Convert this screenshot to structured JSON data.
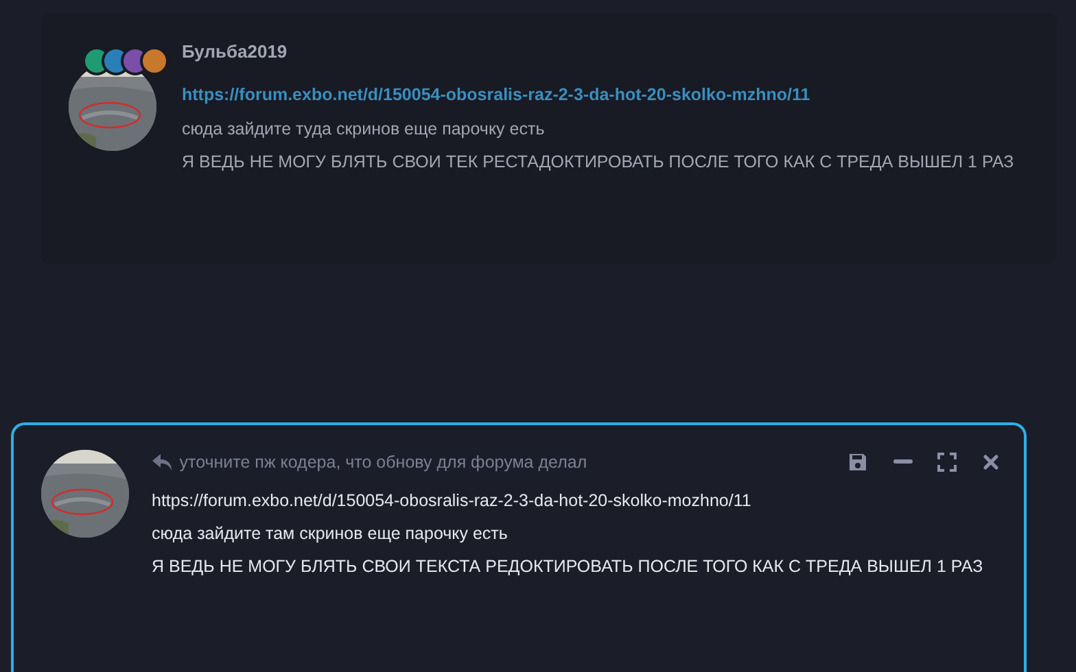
{
  "post": {
    "author": "Бульба2019",
    "badges": [
      {
        "color": "#1f9a72"
      },
      {
        "color": "#2a7fb8"
      },
      {
        "color": "#7b4fa8"
      },
      {
        "color": "#c8782a"
      }
    ],
    "link": "https://forum.exbo.net/d/150054-obosralis-raz-2-3-da-hot-20-skolko-mzhno/11",
    "lines": [
      "сюда зайдите туда скринов еще парочку есть",
      "Я ВЕДЬ НЕ МОГУ БЛЯТЬ СВОИ ТЕК РЕСТАДОКТИРОВАТЬ ПОСЛЕ ТОГО КАК С ТРЕДА ВЫШЕЛ 1 РАЗ"
    ]
  },
  "composer": {
    "reply_to": "уточните пж кодера, что обнову для форума делал",
    "lines": [
      "https://forum.exbo.net/d/150054-obosralis-raz-2-3-da-hot-20-skolko-mozhno/11",
      "сюда зайдите там скринов еще парочку есть",
      "Я ВЕДЬ НЕ МОГУ БЛЯТЬ СВОИ ТЕКСТА РЕДОКТИРОВАТЬ ПОСЛЕ ТОГО КАК С ТРЕДА ВЫШЕЛ 1 РАЗ"
    ]
  }
}
